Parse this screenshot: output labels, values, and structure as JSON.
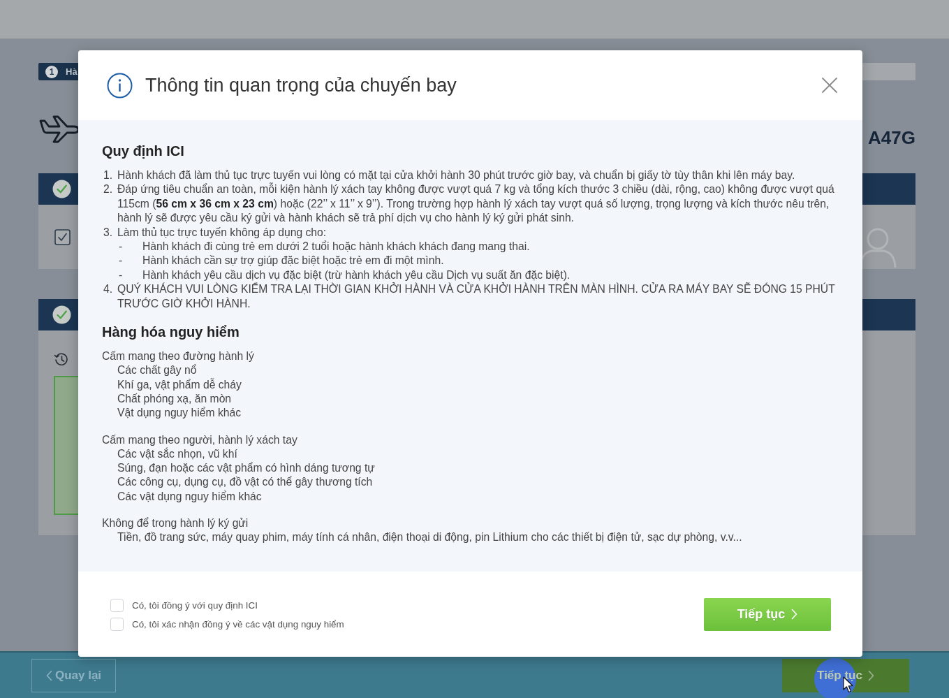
{
  "page": {
    "step_badge": {
      "number": "1",
      "label": "Hà"
    },
    "flight_code": "A47G",
    "sections": [
      {
        "kind": "passengers",
        "completed": true,
        "checked": true
      },
      {
        "kind": "seats",
        "completed": true
      }
    ],
    "back_button": "Quay lại",
    "next_button": "Tiếp tục"
  },
  "dialog": {
    "title": "Thông tin quan trọng của chuyến bay",
    "sections": [
      {
        "kind": "numbered",
        "heading": "Quy định ICI",
        "items": [
          {
            "number": "1.",
            "text": "Hành khách đã làm thủ tục trực tuyến vui lòng có mặt tại cửa khởi hành 30 phút trước giờ bay, và chuẩn bị giấy tờ tùy thân khi lên máy bay."
          },
          {
            "number": "2.",
            "text": "Đáp ứng tiêu chuẩn an toàn, mỗi kiện hành lý xách tay không được vượt quá 7 kg và tổng kích thước 3 chiều (dài, rộng, cao) không được vượt quá 115cm (**56 cm x 36 cm x 23 cm**) hoặc (22’’ x 11’’ x 9’’). Trong trường hợp hành lý xách tay vượt quá số lượng, trọng lượng và kích thước nêu trên, hành lý sẽ được yêu cầu ký gửi và hành khách sẽ trả phí dịch vụ cho hành lý ký gửi phát sinh."
          },
          {
            "number": "3.",
            "text": "Làm thủ tục trực tuyến không áp dụng cho:",
            "children": [
              {
                "marker": "-",
                "text": "Hành khách đi cùng trẻ em dưới 2 tuổi hoặc hành khách khách đang mang thai."
              },
              {
                "marker": "-",
                "text": "Hành khách cần sự trợ giúp đặc biệt hoặc trẻ em đi một mình."
              },
              {
                "marker": "-",
                "text": "Hành khách yêu cầu dịch vụ đặc biệt (trừ hành khách yêu cầu Dịch vụ suất ăn đặc biệt)."
              }
            ]
          },
          {
            "number": "4.",
            "text": "QUÝ KHÁCH VUI LÒNG KIỂM TRA LẠI THỜI GIAN KHỞI HÀNH VÀ CỬA KHỞI HÀNH TRÊN MÀN HÌNH. CỬA RA MÁY BAY SẼ ĐÓNG 15 PHÚT TRƯỚC GIỜ KHỞI HÀNH."
          }
        ]
      },
      {
        "kind": "groups",
        "heading": "Hàng hóa nguy hiểm",
        "groups": [
          {
            "title": "Cấm mang theo đường hành lý",
            "items": [
              "Các chất gây nổ",
              "Khí ga, vật phẩm dễ cháy",
              "Chất phóng xạ, ăn mòn",
              "Vật dụng nguy hiểm khác"
            ]
          },
          {
            "title": "Cấm mang theo người, hành lý xách tay",
            "items": [
              "Các vật sắc nhọn, vũ khí",
              "Súng, đạn hoặc các vật phẩm có hình dáng tương tự",
              "Các công cụ, dụng cụ, đồ vật có thể gây thương tích",
              "Các vật dụng nguy hiểm khác"
            ]
          },
          {
            "title": "Không để trong hành lý ký gửi",
            "items": [
              "Tiền, đồ trang sức, máy quay phim, máy tính cá nhân, điện thoại di động, pin Lithium cho các thiết bị điện tử, sạc dự phòng, v.v..."
            ]
          }
        ]
      }
    ],
    "agreements": [
      {
        "label": "Có, tôi đồng ý với quy định ICI",
        "checked": false
      },
      {
        "label": "Có, tôi xác nhận đồng ý về các vật dụng nguy hiểm",
        "checked": false
      }
    ],
    "continue_button": "Tiếp tục"
  }
}
